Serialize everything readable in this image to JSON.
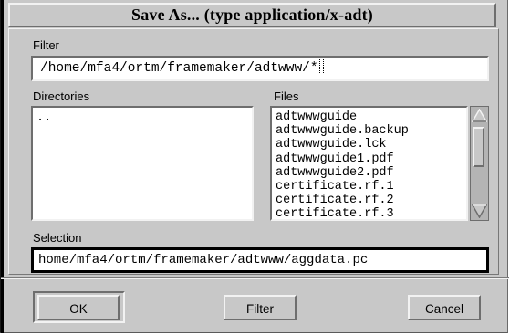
{
  "window": {
    "title": "Save As... (type application/x-adt)"
  },
  "filter": {
    "label": "Filter",
    "value": "/home/mfa4/ortm/framemaker/adtwww/*"
  },
  "directories": {
    "label": "Directories",
    "items": [
      ".."
    ]
  },
  "files": {
    "label": "Files",
    "items": [
      "adtwwwguide",
      "adtwwwguide.backup",
      "adtwwwguide.lck",
      "adtwwwguide1.pdf",
      "adtwwwguide2.pdf",
      "certificate.rf.1",
      "certificate.rf.2",
      "certificate.rf.3"
    ]
  },
  "selection": {
    "label": "Selection",
    "value": "home/mfa4/ortm/framemaker/adtwww/aggdata.pc"
  },
  "buttons": {
    "ok": "OK",
    "filter": "Filter",
    "cancel": "Cancel"
  },
  "colors": {
    "dialog_bg": "#c8c8c8",
    "field_bg": "#ffffff",
    "shadow": "#6e6e6e",
    "highlight": "#f2f2f2"
  }
}
